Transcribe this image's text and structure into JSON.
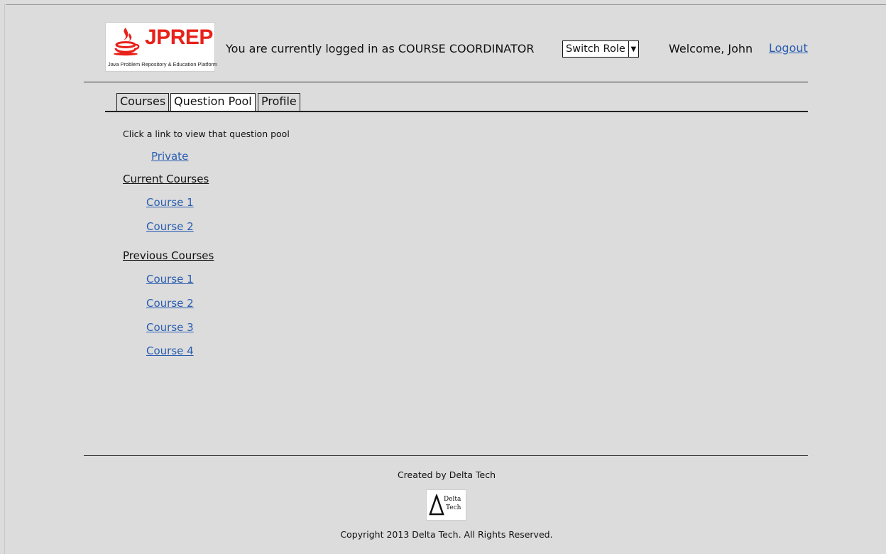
{
  "header": {
    "logo_title": "JPREP",
    "logo_subtitle": "Java Problem Repository & Education Platform",
    "login_status": "You are currently logged in as COURSE COORDINATOR",
    "switch_role_label": "Switch Role",
    "welcome": "Welcome, John",
    "logout_label": "Logout",
    "brand_color": "#e8211a",
    "link_color": "#2a5db0"
  },
  "tabs": [
    {
      "label": "Courses",
      "active": false
    },
    {
      "label": "Question Pool",
      "active": true
    },
    {
      "label": "Profile",
      "active": false
    }
  ],
  "main": {
    "instructions": "Click a link to view that question pool",
    "private_link": "Private",
    "current_heading": "Current Courses",
    "current_courses": [
      "Course 1",
      "Course 2"
    ],
    "previous_heading": "Previous Courses",
    "previous_courses": [
      "Course 1",
      "Course 2",
      "Course 3",
      "Course 4"
    ]
  },
  "footer": {
    "created_by": "Created by Delta Tech",
    "logo_line1": "Delta",
    "logo_line2": "Tech",
    "copyright": "Copyright 2013 Delta Tech. All Rights Reserved."
  }
}
